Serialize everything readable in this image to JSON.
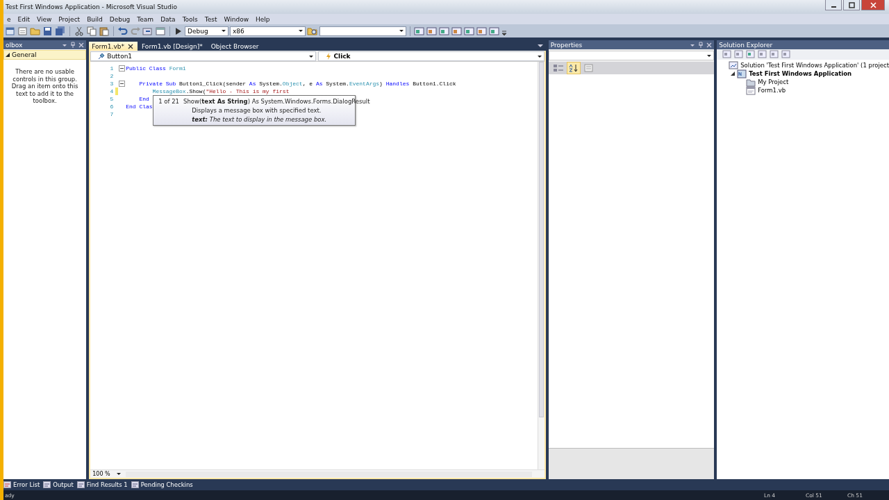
{
  "window": {
    "title": "Test First Windows Application - Microsoft Visual Studio"
  },
  "menu": [
    "e",
    "Edit",
    "View",
    "Project",
    "Build",
    "Debug",
    "Team",
    "Data",
    "Tools",
    "Test",
    "Window",
    "Help"
  ],
  "toolbar": {
    "configuration": "Debug",
    "platform": "x86"
  },
  "toolbox": {
    "title": "olbox",
    "group": {
      "label": "General",
      "expanded": true
    },
    "message": "There are no usable controls in this group. Drag an item onto this text to add it to the toolbox."
  },
  "tabs": [
    {
      "label": "Form1.vb*",
      "selected": true
    },
    {
      "label": "Form1.vb [Design]*",
      "selected": false
    },
    {
      "label": "Object Browser",
      "selected": false
    }
  ],
  "editor": {
    "type_dropdown": "Button1",
    "member_dropdown": "Click",
    "lines": [
      {
        "number": "1",
        "fold": true,
        "changed": false,
        "tokens": [
          {
            "t": "Public Class ",
            "kind": "keyword"
          },
          {
            "t": "Form1",
            "kind": "type"
          }
        ]
      },
      {
        "number": "2",
        "fold": false,
        "changed": false
      },
      {
        "number": "3",
        "fold": true,
        "changed": false,
        "tokens": [
          {
            "t": "    Private Sub ",
            "kind": "keyword"
          },
          {
            "t": "Button1_Click(sender ",
            "kind": "plain"
          },
          {
            "t": "As ",
            "kind": "keyword"
          },
          {
            "t": "System.",
            "kind": "plain"
          },
          {
            "t": "Object",
            "kind": "type"
          },
          {
            "t": ", e ",
            "kind": "plain"
          },
          {
            "t": "As ",
            "kind": "keyword"
          },
          {
            "t": "System.",
            "kind": "plain"
          },
          {
            "t": "EventArgs",
            "kind": "type"
          },
          {
            "t": ") ",
            "kind": "plain"
          },
          {
            "t": "Handles ",
            "kind": "keyword"
          },
          {
            "t": "Button1.Click",
            "kind": "plain"
          }
        ]
      },
      {
        "number": "4",
        "fold": false,
        "changed": true,
        "tokens": [
          {
            "t": "        MessageBox",
            "kind": "type"
          },
          {
            "t": ".Show(",
            "kind": "plain"
          },
          {
            "t": "\"Hello - This is my first ",
            "kind": "string"
          }
        ]
      },
      {
        "number": "5",
        "fold": false,
        "changed": false,
        "tokens": [
          {
            "t": "    End",
            "kind": "keyword"
          }
        ]
      },
      {
        "number": "6",
        "fold": false,
        "changed": false,
        "tokens": [
          {
            "t": "End Clas",
            "kind": "keyword"
          }
        ]
      },
      {
        "number": "7",
        "fold": false,
        "changed": false
      }
    ],
    "tooltip": {
      "counter": "1 of 21",
      "signature": "Show(**text As String**) As System.Windows.Forms.DialogResult",
      "description": "Displays a message box with specified text.",
      "parameter": "**text:** The text to display in the message box."
    },
    "zoom": "100 %"
  },
  "properties": {
    "title": "Properties",
    "toolbar": [
      {
        "kind": "categorized",
        "selected": false
      },
      {
        "kind": "alphabetical",
        "selected": true
      },
      {
        "kind": "pages",
        "selected": false
      }
    ]
  },
  "solution_explorer": {
    "title": "Solution Explorer",
    "tree": [
      {
        "label": "Solution 'Test First Windows Application' (1 project",
        "kind": "solution",
        "children": [
          {
            "label": "Test First Windows Application",
            "kind": "project",
            "expanded": true,
            "children": [
              {
                "label": "My Project",
                "kind": "folder"
              },
              {
                "label": "Form1.vb",
                "kind": "file"
              }
            ]
          }
        ]
      }
    ]
  },
  "bottom_tabs": [
    "Error List",
    "Output",
    "Find Results 1",
    "Pending Checkins"
  ],
  "status_bar": {
    "message": "ady",
    "line": "Ln 4",
    "column": "Col 51",
    "char": "Ch 51"
  }
}
